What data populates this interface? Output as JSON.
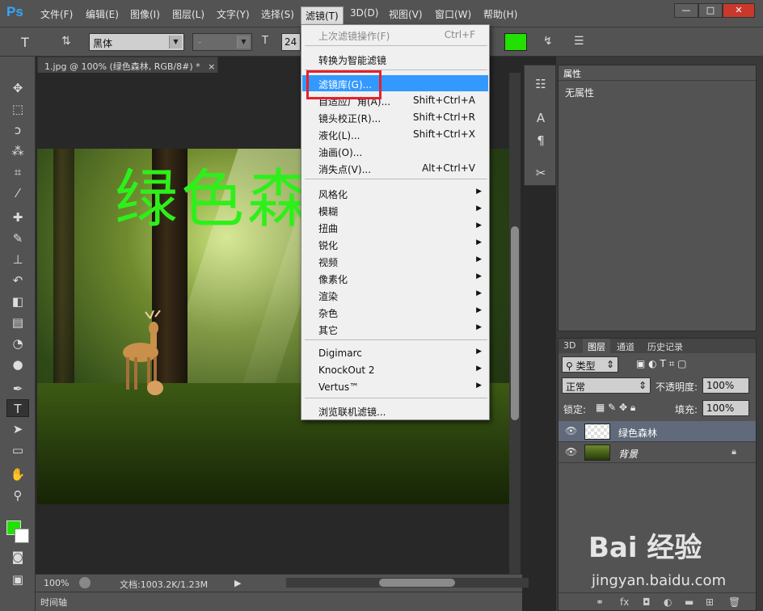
{
  "app": {
    "logo": "Ps"
  },
  "menubar": {
    "items": [
      {
        "label": "文件(F)"
      },
      {
        "label": "编辑(E)"
      },
      {
        "label": "图像(I)"
      },
      {
        "label": "图层(L)"
      },
      {
        "label": "文字(Y)"
      },
      {
        "label": "选择(S)"
      },
      {
        "label": "滤镜(T)"
      },
      {
        "label": "3D(D)"
      },
      {
        "label": "视图(V)"
      },
      {
        "label": "窗口(W)"
      },
      {
        "label": "帮助(H)"
      }
    ],
    "window_controls": [
      "—",
      "□",
      "✕"
    ]
  },
  "options": {
    "font_family": "黑体",
    "font_style": "-",
    "font_size": "24",
    "text_color": "#22e000"
  },
  "document": {
    "tab_title": "1.jpg @ 100% (绿色森林, RGB/8#) *",
    "tab_close": "×",
    "canvas_text": "绿色森",
    "zoom": "100%",
    "doc_info": "文档:1003.2K/1.23M",
    "timeline_label": "时间轴"
  },
  "filter_menu": {
    "items": [
      {
        "label": "上次滤镜操作(F)",
        "shortcut": "Ctrl+F",
        "disabled": true
      },
      {
        "label": "转换为智能滤镜"
      },
      {
        "label": "滤镜库(G)...",
        "highlight": true
      },
      {
        "label": "自适应广角(A)...",
        "shortcut": "Shift+Ctrl+A"
      },
      {
        "label": "镜头校正(R)...",
        "shortcut": "Shift+Ctrl+R"
      },
      {
        "label": "液化(L)...",
        "shortcut": "Shift+Ctrl+X"
      },
      {
        "label": "油画(O)..."
      },
      {
        "label": "消失点(V)...",
        "shortcut": "Alt+Ctrl+V"
      },
      {
        "label": "风格化"
      },
      {
        "label": "模糊"
      },
      {
        "label": "扭曲"
      },
      {
        "label": "锐化"
      },
      {
        "label": "视频"
      },
      {
        "label": "像素化"
      },
      {
        "label": "渲染"
      },
      {
        "label": "杂色"
      },
      {
        "label": "其它"
      },
      {
        "label": "Digimarc"
      },
      {
        "label": "KnockOut 2"
      },
      {
        "label": "Vertus™"
      },
      {
        "label": "浏览联机滤镜..."
      }
    ]
  },
  "properties_panel": {
    "tab": "属性",
    "body": "无属性"
  },
  "layers_panel": {
    "tabs": [
      "3D",
      "图层",
      "通道",
      "历史记录"
    ],
    "filter_kind": "类型",
    "blend_mode": "正常",
    "opacity_label": "不透明度:",
    "opacity_value": "100%",
    "lock_label": "锁定:",
    "fill_label": "填充:",
    "fill_value": "100%",
    "layers": [
      {
        "name": "绿色森林",
        "selected": true
      },
      {
        "name": "背景",
        "locked": true
      }
    ],
    "footer_icons": [
      "link-icon",
      "fx-icon",
      "mask-icon",
      "adjustment-icon",
      "group-icon",
      "new-layer-icon",
      "trash-icon"
    ]
  },
  "watermark": {
    "brand": "Bai 经验",
    "url": "jingyan.baidu.com"
  },
  "colors": {
    "foreground": "#22e000",
    "background": "#ffffff",
    "menu_highlight": "#3399ff",
    "annotation_red": "#e8202a"
  }
}
